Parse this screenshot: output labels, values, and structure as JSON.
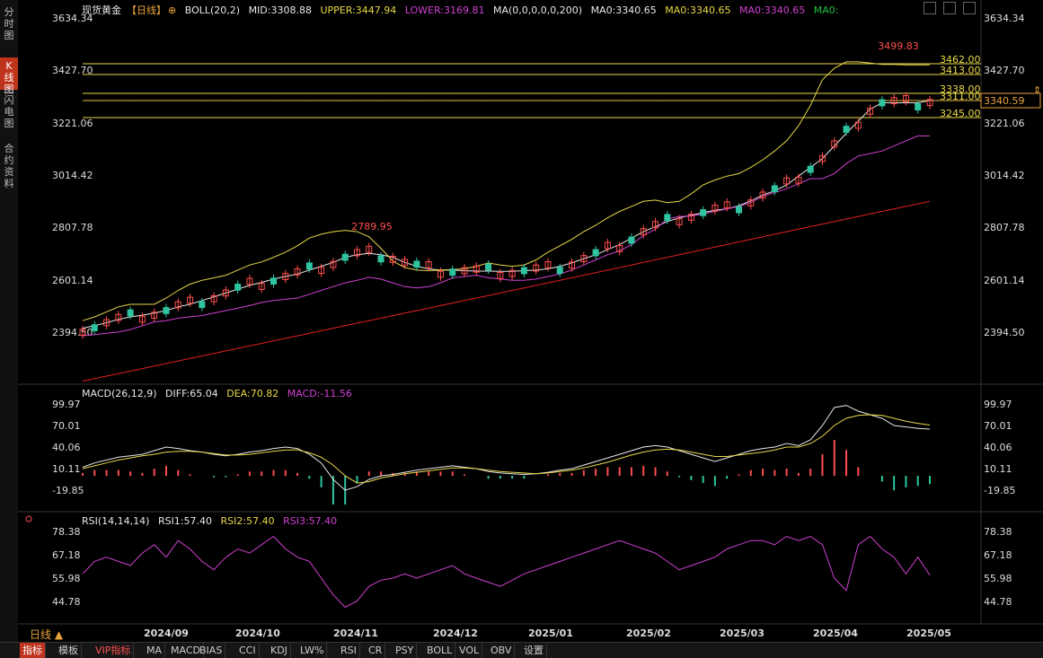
{
  "left_tabs": [
    {
      "label": "分时图",
      "active": false
    },
    {
      "label": "K线图",
      "active": true
    },
    {
      "label": "闪电图",
      "active": false
    },
    {
      "label": "合约资料",
      "active": false
    }
  ],
  "legend": {
    "instrument": "现货黄金",
    "period_tag": "【日线】",
    "boll": "BOLL(20,2)",
    "mid": "MID:3308.88",
    "upper": "UPPER:3447.94",
    "lower": "LOWER:3169.81",
    "ma": "MA(0,0,0,0,0,200)",
    "ma0a": "MA0:3340.65",
    "ma0b": "MA0:3340.65",
    "ma0c": "MA0:3340.65",
    "ma0d": "MA0:"
  },
  "macd_legend": {
    "name": "MACD(26,12,9)",
    "diff": "DIFF:65.04",
    "dea": "DEA:70.82",
    "macd": "MACD:-11.56"
  },
  "rsi_legend": {
    "name": "RSI(14,14,14)",
    "rsi1": "RSI1:57.40",
    "rsi2": "RSI2:57.40",
    "rsi3": "RSI3:57.40"
  },
  "period_label": "日线 ▲",
  "bottom_tabs": [
    "指标",
    "模板",
    "VIP指标",
    "MA",
    "MACD",
    "BIAS",
    "CCI",
    "KDJ",
    "LW%",
    "RSI",
    "CR",
    "PSY",
    "BOLL",
    "VOL",
    "OBV",
    "设置"
  ],
  "colors": {
    "up": "#ff4d4d",
    "down": "#2ec4a0",
    "boll_mid": "#e8e8e8",
    "boll_upper": "#e8d84a",
    "boll_lower": "#d040d0",
    "ma200": "#e02020",
    "hline": "#e8d84a",
    "price_tag": "#e8a23a"
  },
  "chart_data": [
    {
      "type": "candlestick",
      "ylim": [
        2300,
        3700
      ],
      "y_ticks": [
        3634.34,
        3427.7,
        3221.06,
        3014.42,
        2807.78,
        2601.14,
        2394.5
      ],
      "x_ticks": [
        "2024/09",
        "2024/10",
        "2024/11",
        "2024/12",
        "2025/01",
        "2025/02",
        "2025/03",
        "2025/04",
        "2025/05"
      ],
      "horizontal_levels": [
        3462.0,
        3413.0,
        3338.0,
        3311.0,
        3245.0
      ],
      "annotations": [
        {
          "label": "3499.83"
        },
        {
          "label": "2789.95"
        }
      ],
      "current_price": "3340.59",
      "series": [
        {
          "name": "MID",
          "values": [
            2410,
            2420,
            2432,
            2445,
            2455,
            2462,
            2470,
            2480,
            2495,
            2505,
            2520,
            2535,
            2550,
            2565,
            2580,
            2592,
            2605,
            2615,
            2625,
            2640,
            2655,
            2670,
            2690,
            2700,
            2705,
            2700,
            2690,
            2670,
            2655,
            2645,
            2640,
            2640,
            2638,
            2636,
            2636,
            2635,
            2635,
            2638,
            2640,
            2645,
            2655,
            2668,
            2685,
            2700,
            2720,
            2740,
            2765,
            2790,
            2810,
            2830,
            2845,
            2855,
            2865,
            2875,
            2880,
            2893,
            2912,
            2935,
            2952,
            2975,
            3010,
            3045,
            3080,
            3130,
            3180,
            3228,
            3275,
            3300,
            3300,
            3300,
            3300,
            3308.88
          ]
        },
        {
          "name": "UPPER",
          "values": [
            2440,
            2455,
            2475,
            2495,
            2505,
            2505,
            2505,
            2530,
            2560,
            2585,
            2600,
            2610,
            2620,
            2640,
            2660,
            2672,
            2690,
            2710,
            2735,
            2765,
            2780,
            2790,
            2795,
            2790,
            2770,
            2725,
            2675,
            2650,
            2640,
            2638,
            2640,
            2642,
            2645,
            2655,
            2668,
            2660,
            2655,
            2660,
            2680,
            2710,
            2735,
            2760,
            2790,
            2815,
            2845,
            2870,
            2890,
            2910,
            2915,
            2905,
            2910,
            2940,
            2975,
            2995,
            3010,
            3020,
            3045,
            3075,
            3110,
            3150,
            3210,
            3290,
            3390,
            3435,
            3460,
            3460,
            3455,
            3450,
            3450,
            3447.94,
            3447.94,
            3447.94
          ]
        },
        {
          "name": "LOWER",
          "values": [
            2380,
            2385,
            2390,
            2395,
            2405,
            2420,
            2435,
            2440,
            2450,
            2455,
            2460,
            2470,
            2480,
            2490,
            2500,
            2512,
            2520,
            2525,
            2530,
            2545,
            2560,
            2575,
            2590,
            2600,
            2612,
            2605,
            2590,
            2575,
            2570,
            2575,
            2590,
            2610,
            2615,
            2620,
            2610,
            2605,
            2600,
            2600,
            2605,
            2615,
            2625,
            2640,
            2660,
            2680,
            2700,
            2715,
            2740,
            2775,
            2800,
            2840,
            2850,
            2852,
            2860,
            2870,
            2880,
            2890,
            2905,
            2930,
            2945,
            2960,
            2980,
            3000,
            3000,
            3020,
            3060,
            3090,
            3100,
            3110,
            3130,
            3150,
            3169.81,
            3169.81
          ]
        },
        {
          "name": "MA200",
          "values": [
            2200,
            2210,
            2220,
            2230,
            2240,
            2250,
            2260,
            2270,
            2280,
            2290,
            2300,
            2310,
            2320,
            2330,
            2340,
            2350,
            2360,
            2370,
            2380,
            2390,
            2400,
            2410,
            2420,
            2430,
            2440,
            2450,
            2460,
            2470,
            2480,
            2490,
            2500,
            2510,
            2520,
            2530,
            2540,
            2550,
            2560,
            2570,
            2580,
            2590,
            2600,
            2610,
            2620,
            2630,
            2640,
            2650,
            2660,
            2670,
            2680,
            2690,
            2700,
            2710,
            2720,
            2730,
            2740,
            2750,
            2760,
            2770,
            2780,
            2790,
            2800,
            2810,
            2820,
            2830,
            2840,
            2850,
            2860,
            2870,
            2880,
            2890,
            2900,
            2910
          ]
        }
      ]
    },
    {
      "type": "macd",
      "ylim": [
        -30,
        110
      ],
      "y_ticks": [
        99.97,
        70.01,
        40.06,
        10.11,
        -19.85
      ],
      "series": [
        {
          "name": "DIFF",
          "values": [
            12,
            18,
            22,
            26,
            28,
            30,
            35,
            40,
            38,
            35,
            33,
            30,
            28,
            30,
            33,
            35,
            38,
            40,
            38,
            30,
            18,
            -5,
            -20,
            -15,
            -5,
            0,
            2,
            5,
            8,
            10,
            12,
            14,
            12,
            10,
            6,
            4,
            3,
            2,
            3,
            5,
            8,
            10,
            15,
            20,
            25,
            30,
            35,
            40,
            42,
            40,
            35,
            30,
            25,
            20,
            25,
            30,
            35,
            38,
            40,
            45,
            42,
            50,
            70,
            95,
            98,
            90,
            85,
            80,
            70,
            68,
            66,
            65.04
          ]
        },
        {
          "name": "DEA",
          "values": [
            10,
            14,
            18,
            22,
            25,
            28,
            30,
            33,
            34,
            34,
            33,
            31,
            29,
            29,
            30,
            32,
            34,
            36,
            36,
            32,
            26,
            15,
            0,
            -10,
            -8,
            -3,
            0,
            3,
            5,
            7,
            9,
            11,
            11,
            10,
            8,
            6,
            5,
            4,
            3,
            4,
            6,
            8,
            11,
            15,
            19,
            24,
            29,
            33,
            36,
            37,
            36,
            33,
            30,
            27,
            27,
            29,
            31,
            33,
            36,
            40,
            40,
            45,
            55,
            70,
            80,
            84,
            85,
            84,
            80,
            76,
            73,
            70.82
          ]
        },
        {
          "name": "MACD",
          "values": [
            4,
            8,
            8,
            8,
            6,
            4,
            10,
            14,
            8,
            2,
            0,
            -2,
            -2,
            2,
            6,
            6,
            8,
            8,
            4,
            -4,
            -16,
            -40,
            -40,
            -10,
            6,
            6,
            4,
            4,
            6,
            6,
            6,
            6,
            2,
            0,
            -4,
            -4,
            -4,
            -4,
            0,
            2,
            4,
            4,
            8,
            10,
            12,
            12,
            12,
            14,
            12,
            6,
            -2,
            -6,
            -10,
            -14,
            -4,
            2,
            8,
            10,
            8,
            10,
            4,
            10,
            30,
            50,
            36,
            12,
            0,
            -8,
            -20,
            -16,
            -14,
            -11.56
          ]
        }
      ]
    },
    {
      "type": "line",
      "ylim": [
        40,
        82
      ],
      "y_ticks": [
        78.38,
        67.18,
        55.98,
        44.78
      ],
      "series": [
        {
          "name": "RSI1",
          "values": [
            58,
            64,
            66,
            64,
            62,
            68,
            72,
            66,
            74,
            70,
            64,
            60,
            66,
            70,
            68,
            72,
            76,
            70,
            66,
            64,
            56,
            48,
            42,
            45,
            52,
            55,
            56,
            58,
            56,
            58,
            60,
            62,
            58,
            56,
            54,
            52,
            55,
            58,
            60,
            62,
            64,
            66,
            68,
            70,
            72,
            74,
            72,
            70,
            68,
            64,
            60,
            62,
            64,
            66,
            70,
            72,
            74,
            74,
            72,
            76,
            74,
            76,
            72,
            56,
            50,
            72,
            76,
            70,
            66,
            58,
            66,
            57.4
          ]
        }
      ]
    }
  ]
}
